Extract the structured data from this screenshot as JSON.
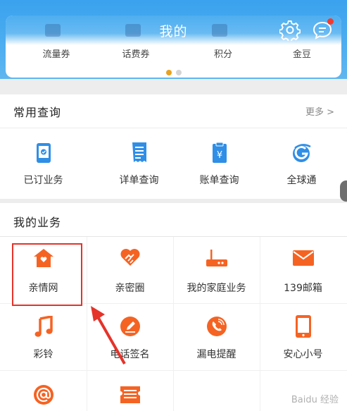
{
  "header": {
    "title": "我的",
    "badge": true
  },
  "assets": {
    "items": [
      {
        "label": "流量券"
      },
      {
        "label": "话费券"
      },
      {
        "label": "积分"
      },
      {
        "label": "金豆"
      }
    ],
    "page_indicator": {
      "current": 1,
      "total": 2
    }
  },
  "common_queries": {
    "title": "常用查询",
    "more_label": "更多 >",
    "items": [
      {
        "label": "已订业务",
        "icon": "subscribed-service-icon"
      },
      {
        "label": "详单查询",
        "icon": "detail-bill-icon"
      },
      {
        "label": "账单查询",
        "icon": "bill-query-icon"
      },
      {
        "label": "全球通",
        "icon": "global-pass-icon"
      }
    ]
  },
  "my_services": {
    "title": "我的业务",
    "items": [
      {
        "label": "亲情网",
        "icon": "family-home-icon"
      },
      {
        "label": "亲密圈",
        "icon": "heart-handshake-icon"
      },
      {
        "label": "我的家庭业务",
        "icon": "router-icon"
      },
      {
        "label": "139邮箱",
        "icon": "mail-icon"
      },
      {
        "label": "彩铃",
        "icon": "music-note-icon"
      },
      {
        "label": "电话签名",
        "icon": "signature-icon"
      },
      {
        "label": "漏电提醒",
        "icon": "missed-call-icon"
      },
      {
        "label": "安心小号",
        "icon": "phone-number-icon"
      },
      {
        "label": "",
        "icon": "at-sign-icon"
      },
      {
        "label": "",
        "icon": "ticket-list-icon"
      }
    ]
  },
  "watermark": "Baidu 经验",
  "colors": {
    "header_blue": "#4eaef0",
    "accent_orange": "#f56323",
    "query_blue": "#2f8ee6",
    "highlight_red": "#e5332a"
  }
}
